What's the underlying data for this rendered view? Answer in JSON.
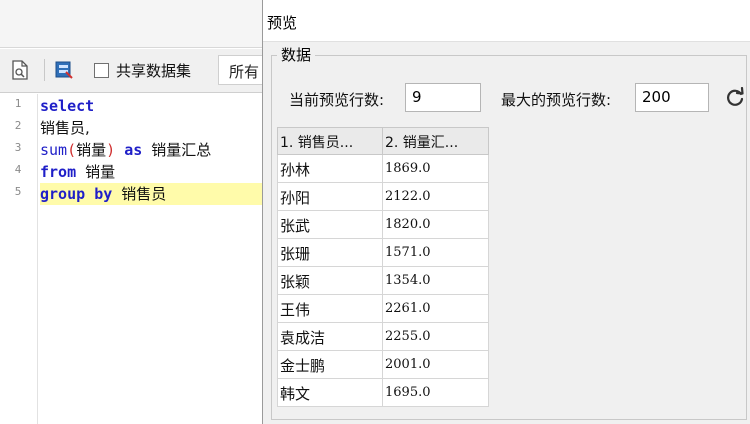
{
  "editor": {
    "toolbar": {
      "share_dataset_label": "共享数据集",
      "dropdown_value": "所有"
    },
    "line_numbers": [
      "1",
      "2",
      "3",
      "4",
      "5"
    ],
    "code": {
      "l1_kw": "select",
      "l2_text": "销售员,",
      "l3_fn": "sum",
      "l3_open": "(",
      "l3_arg": "销量",
      "l3_close": ")",
      "l3_kw": "as",
      "l3_alias": "销量汇总",
      "l4_kw": "from",
      "l4_table": "销量",
      "l5_kw1": "group",
      "l5_kw2": "by",
      "l5_col": "销售员"
    }
  },
  "preview": {
    "title": "预览",
    "group_title": "数据",
    "current_rows_label": "当前预览行数:",
    "current_rows_value": "9",
    "max_rows_label": "最大的预览行数:",
    "max_rows_value": "200",
    "refresh_icon": "refresh-icon",
    "table": {
      "headers": [
        "1. 销售员...",
        "2. 销量汇..."
      ],
      "rows": [
        [
          "孙林",
          "1869.0"
        ],
        [
          "孙阳",
          "2122.0"
        ],
        [
          "张武",
          "1820.0"
        ],
        [
          "张珊",
          "1571.0"
        ],
        [
          "张颖",
          "1354.0"
        ],
        [
          "王伟",
          "2261.0"
        ],
        [
          "袁成洁",
          "2255.0"
        ],
        [
          "金士鹏",
          "2001.0"
        ],
        [
          "韩文",
          "1695.0"
        ]
      ]
    }
  },
  "colors": {
    "keyword": "#1f1fc8",
    "paren": "#d03030",
    "highlight_line": "#fffbaa",
    "dialog_bg": "#f0f0f0"
  }
}
